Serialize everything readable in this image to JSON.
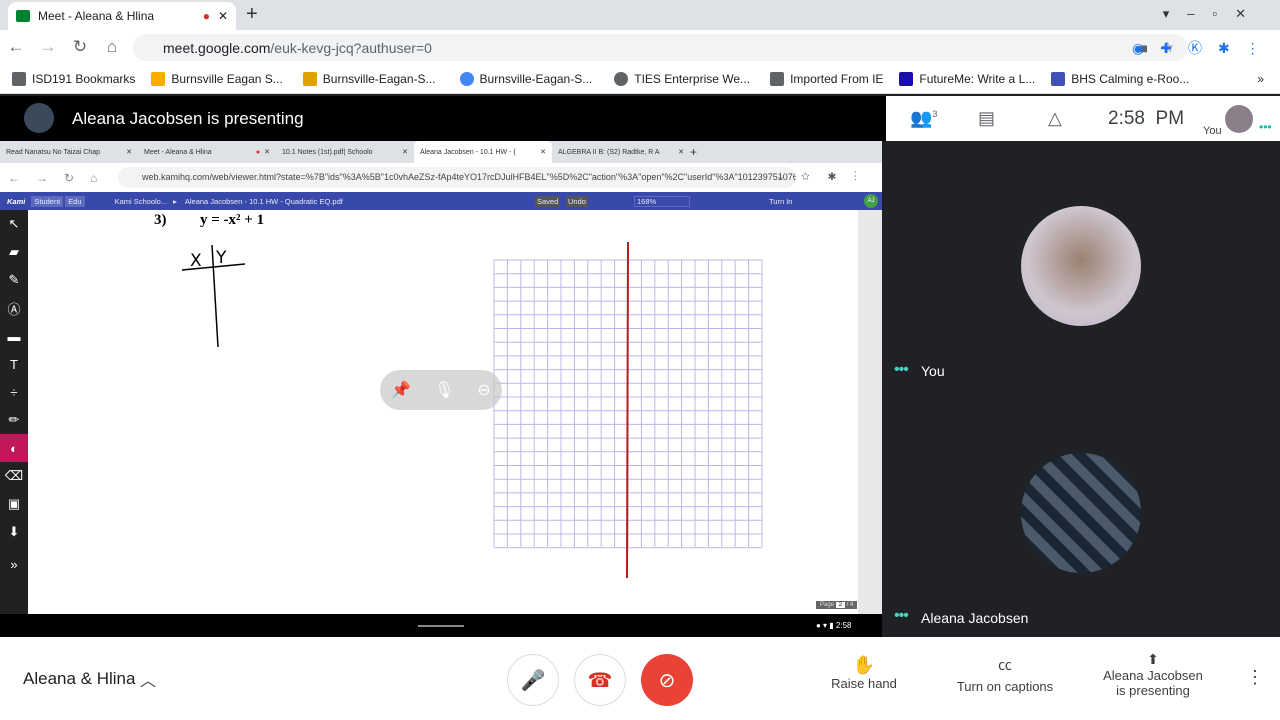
{
  "browser": {
    "tab_title": "Meet - Aleana & Hlina",
    "new_tab": "+",
    "url_host": "meet.google.com",
    "url_path": "/euk-kevg-jcq?authuser=0",
    "bookmarks": [
      "ISD191 Bookmarks",
      "Burnsville Eagan S...",
      "Burnsville-Eagan-S...",
      "Burnsville-Eagan-S...",
      "TIES Enterprise We...",
      "Imported From IE",
      "FutureMe: Write a L...",
      "BHS Calming e-Roo..."
    ],
    "more": "»"
  },
  "meet": {
    "presenting_banner": "Aleana Jacobsen is presenting",
    "participant_count": "3",
    "time": "2:58  PM",
    "self_label": "You",
    "tiles": [
      {
        "name": "You"
      },
      {
        "name": "Aleana Jacobsen"
      }
    ],
    "meeting_name": "Aleana & Hlina",
    "actions": {
      "raise_hand": "Raise hand",
      "captions": "Turn on captions",
      "presenting_line1": "Aleana Jacobsen",
      "presenting_line2": "is presenting"
    }
  },
  "shared": {
    "tabs": [
      "Read Nanatsu No Taizai Chap",
      "Meet - Aleana & Hlina",
      "10.1 Notes (1st).pdf| Schoolo",
      "Aleana Jacobsen - 10.1 HW - (",
      "ALGEBRA II B: (S2) Radtke, R A"
    ],
    "url": "web.kamihq.com/web/viewer.html?state=%7B\"ids\"%3A%5B\"1c0vhAeZSz-fAp4teYO17rcDJuiHFB4EL\"%5D%2C\"action\"%3A\"open\"%2C\"userId\"%3A\"101239751076...",
    "kami": {
      "logo": "Kami",
      "student": "Student",
      "edu": "Edu",
      "crumb1": "Kami Schoolo...",
      "crumb_sep": "▸",
      "file": "Aleana Jacobsen - 10.1 HW - Quadratic EQ.pdf",
      "saved": "Saved",
      "undo": "Undo",
      "zoom": "168%",
      "turn_in": "Turn In",
      "avatar": "AJ"
    },
    "doc": {
      "problem_number": "3)",
      "equation": "y = -x² + 1",
      "col_x": "X",
      "col_y": "Y"
    },
    "page": "Page",
    "page_num": "2",
    "page_total": "/ 4",
    "shelf_time": "2:58",
    "colors": {
      "black": "#000000",
      "red": "#b71c1c",
      "brown": "#6d3b1f"
    }
  }
}
